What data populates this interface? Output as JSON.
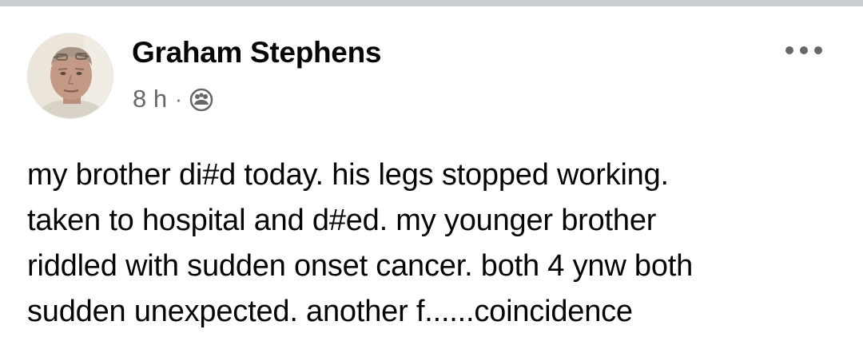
{
  "post": {
    "author_name": "Graham Stephens",
    "timestamp": "8 h",
    "separator": "·",
    "audience_icon": "friends-icon",
    "more_icon": "more-options-icon",
    "body_text": "my brother di#d today. his legs stopped working.\ntaken to hospital and d#ed. my younger brother\nriddled with sudden onset cancer. both 4 ynw both\nsudden unexpected. another f......coincidence"
  },
  "colors": {
    "name": "#050505",
    "meta": "#65676b",
    "top_bar": "#c9ccd1"
  }
}
